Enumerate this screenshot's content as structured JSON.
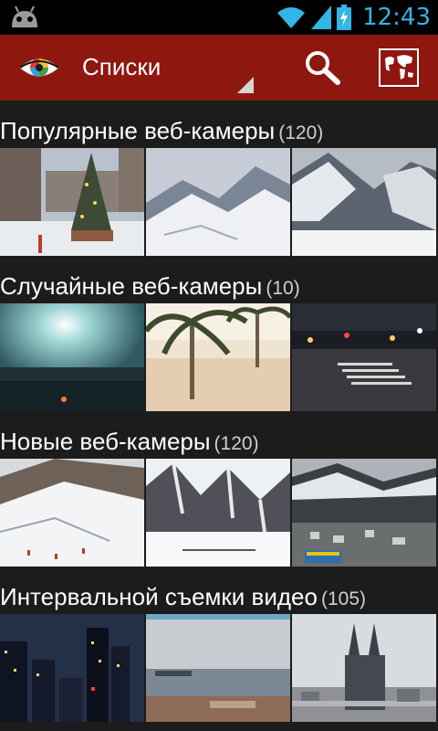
{
  "statusbar": {
    "time": "12:43",
    "icons": [
      "android-icon",
      "wifi-icon",
      "signal-icon",
      "battery-charging-icon"
    ]
  },
  "actionbar": {
    "title": "Списки",
    "icons": [
      "app-eye-logo-icon",
      "search-icon",
      "world-map-icon"
    ]
  },
  "colors": {
    "actionbar": "#8e1710",
    "accent": "#33b5e5",
    "background": "#1c1c1c"
  },
  "sections": [
    {
      "title": "Популярные веб-камеры",
      "count": "(120)",
      "thumbs": [
        "christmas-tree-town-square-webcam",
        "snowy-mountains-webcam",
        "snowy-valley-webcam"
      ]
    },
    {
      "title": "Случайные веб-камеры",
      "count": "(10)",
      "thumbs": [
        "sun-over-sea-webcam",
        "palm-trees-beach-webcam",
        "night-street-webcam"
      ]
    },
    {
      "title": "Новые веб-камеры",
      "count": "(120)",
      "thumbs": [
        "ski-slope-webcam",
        "snowy-peaks-webcam",
        "mountain-village-webcam"
      ]
    },
    {
      "title": "Интервальной съемки видео",
      "count": "(105)",
      "thumbs": [
        "city-skyline-night-webcam",
        "harbor-sea-webcam",
        "cathedral-city-webcam"
      ]
    }
  ]
}
